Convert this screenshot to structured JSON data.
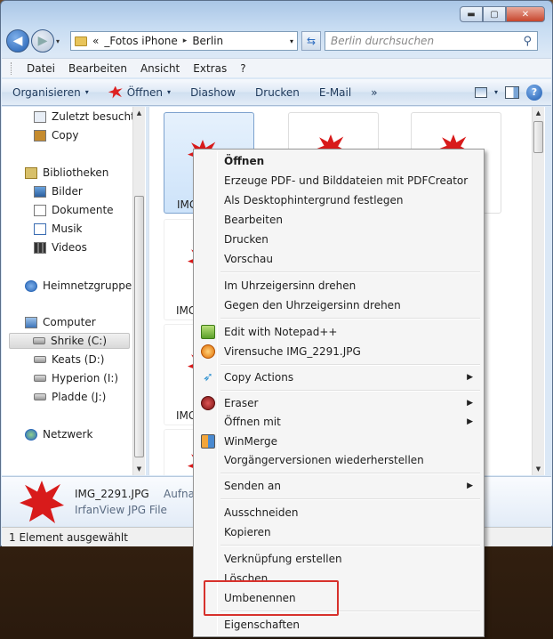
{
  "window": {
    "caption_buttons": {
      "minimize": "▬",
      "maximize": "▢",
      "close": "✕"
    }
  },
  "nav": {
    "back_icon": "◀",
    "forward_icon": "▶",
    "history_dropdown": "▾"
  },
  "address": {
    "overflow": "«",
    "crumbs": [
      "_Fotos iPhone",
      "Berlin"
    ],
    "separator": "▸",
    "dropdown": "▾",
    "refresh_icon": "⇆"
  },
  "search": {
    "placeholder": "Berlin durchsuchen",
    "icon": "⚲"
  },
  "menubar": [
    "Datei",
    "Bearbeiten",
    "Ansicht",
    "Extras",
    "?"
  ],
  "cmdbar": {
    "organize": "Organisieren",
    "open": "Öffnen",
    "slideshow": "Diashow",
    "print": "Drucken",
    "email": "E-Mail",
    "more": "»",
    "dropdown": "▾",
    "help": "?"
  },
  "navpane": {
    "recent": "Zuletzt besucht",
    "copy": "Copy",
    "libraries": "Bibliotheken",
    "pictures": "Bilder",
    "documents": "Dokumente",
    "music": "Musik",
    "videos": "Videos",
    "homegroup": "Heimnetzgruppe",
    "computer": "Computer",
    "drives": [
      "Shrike (C:)",
      "Keats (D:)",
      "Hyperion (I:)",
      "Pladde (J:)"
    ],
    "network": "Netzwerk"
  },
  "content": {
    "selected_label": "IMG_",
    "row_labels": [
      "IMG",
      "IMG"
    ]
  },
  "details": {
    "filename": "IMG_2291.JPG",
    "aufnahme": "Aufnal",
    "filetype": "IrfanView JPG File"
  },
  "status": {
    "text": "1 Element ausgewählt"
  },
  "scroll": {
    "up": "▲",
    "down": "▼"
  },
  "context_menu": {
    "submenu_arrow": "▶",
    "items": [
      "Öffnen",
      "Erzeuge PDF- und Bilddateien mit PDFCreator",
      "Als Desktophintergrund festlegen",
      "Bearbeiten",
      "Drucken",
      "Vorschau",
      "Im Uhrzeigersinn drehen",
      "Gegen den Uhrzeigersinn drehen",
      "Edit with Notepad++",
      "Virensuche IMG_2291.JPG",
      "Copy Actions",
      "Eraser",
      "Öffnen mit",
      "WinMerge",
      "Vorgängerversionen wiederherstellen",
      "Senden an",
      "Ausschneiden",
      "Kopieren",
      "Verknüpfung erstellen",
      "Löschen",
      "Umbenennen",
      "Eigenschaften"
    ]
  },
  "colors": {
    "highlight": "#d7312c",
    "selection": "#cde3fa",
    "irfanview_red": "#d81b1b"
  }
}
